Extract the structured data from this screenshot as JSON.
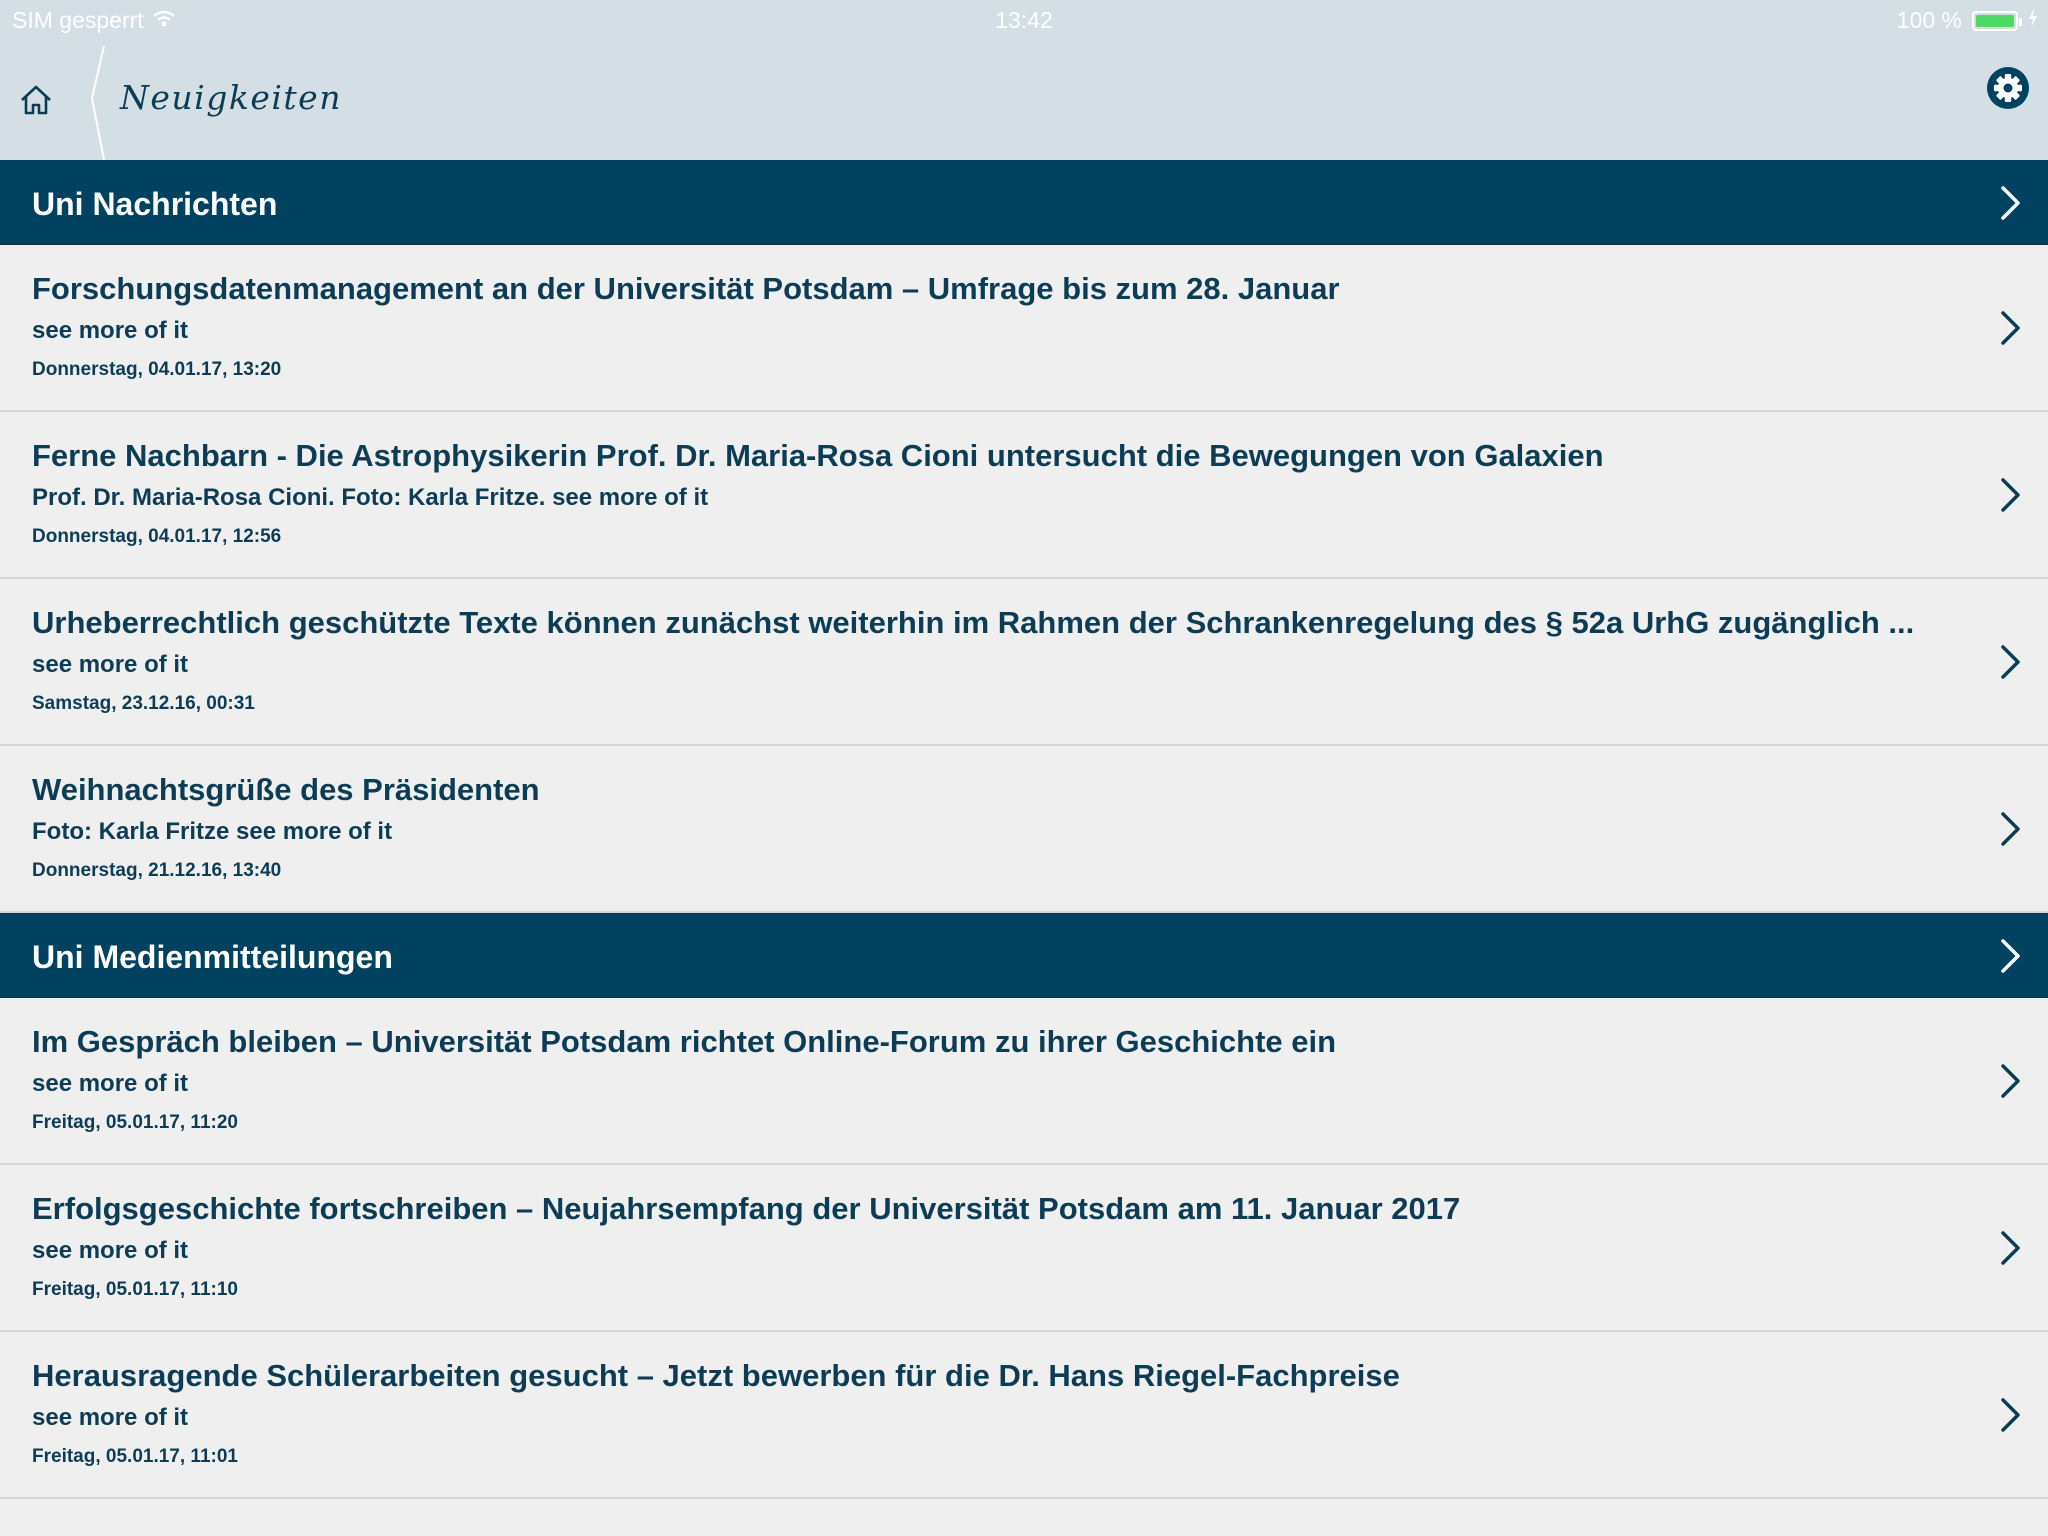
{
  "status_bar": {
    "carrier": "SIM gesperrt",
    "time": "13:42",
    "battery": "100 %",
    "battery_color": "#4cd964"
  },
  "nav": {
    "title": "Neuigkeiten",
    "home_icon": "home-icon",
    "settings_icon": "gear-icon"
  },
  "colors": {
    "header_bg": "#d3dee5",
    "section_bg": "#00425f",
    "text": "#0d3d55",
    "list_bg": "#efefef"
  },
  "sections": [
    {
      "title": "Uni Nachrichten",
      "items": [
        {
          "title": "Forschungsdatenmanagement an der Universität Potsdam – Umfrage bis zum 28. Januar",
          "subtitle": "see more of it",
          "date": "Donnerstag, 04.01.17, 13:20"
        },
        {
          "title": "Ferne Nachbarn - Die Astrophysikerin Prof. Dr. Maria-Rosa Cioni untersucht die Bewegungen von Galaxien",
          "subtitle": "Prof. Dr. Maria-Rosa Cioni. Foto: Karla Fritze. see more of it",
          "date": "Donnerstag, 04.01.17, 12:56"
        },
        {
          "title": "Urheberrechtlich geschützte Texte können zunächst weiterhin im Rahmen der Schrankenregelung des § 52a UrhG zugänglich ...",
          "subtitle": "see more of it",
          "date": "Samstag, 23.12.16, 00:31"
        },
        {
          "title": "Weihnachtsgrüße des Präsidenten",
          "subtitle": "Foto: Karla Fritze see more of it",
          "date": "Donnerstag, 21.12.16, 13:40"
        }
      ]
    },
    {
      "title": "Uni Medienmitteilungen",
      "items": [
        {
          "title": "Im Gespräch bleiben – Universität Potsdam richtet Online-Forum zu ihrer Geschichte ein",
          "subtitle": "see more of it",
          "date": "Freitag, 05.01.17, 11:20"
        },
        {
          "title": "Erfolgsgeschichte fortschreiben – Neujahrsempfang der Universität Potsdam am 11. Januar 2017",
          "subtitle": "see more of it",
          "date": "Freitag, 05.01.17, 11:10"
        },
        {
          "title": "Herausragende Schülerarbeiten gesucht – Jetzt bewerben für die Dr. Hans Riegel-Fachpreise",
          "subtitle": "see more of it",
          "date": "Freitag, 05.01.17, 11:01"
        }
      ]
    }
  ]
}
